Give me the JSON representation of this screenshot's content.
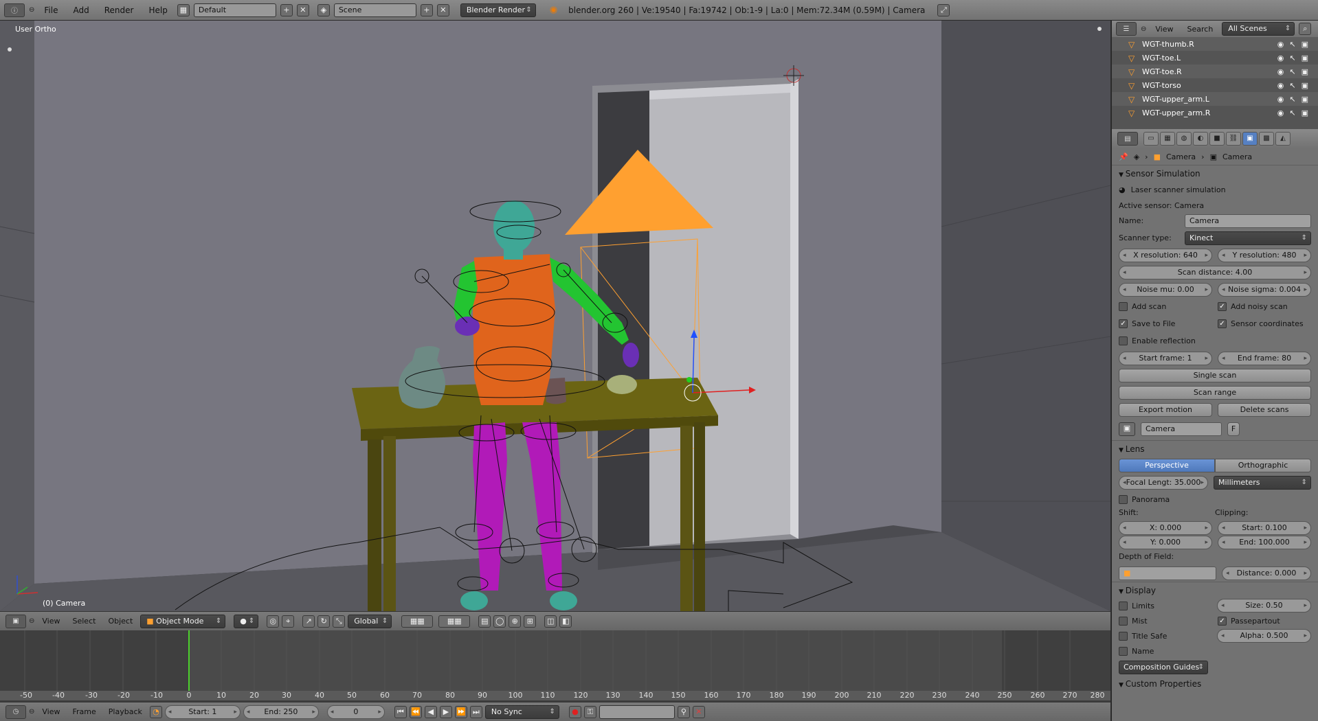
{
  "topbar": {
    "menus": [
      "File",
      "Add",
      "Render",
      "Help"
    ],
    "layout": "Default",
    "scene": "Scene",
    "engine": "Blender Render",
    "stats": "blender.org 260 | Ve:19540 | Fa:19742 | Ob:1-9 | La:0 | Mem:72.34M (0.59M) | Camera"
  },
  "viewport": {
    "view_label": "User Ortho",
    "object_label": "(0) Camera"
  },
  "viewport_header": {
    "menus": [
      "View",
      "Select",
      "Object"
    ],
    "mode": "Object Mode",
    "orientation": "Global"
  },
  "timeline": {
    "ruler": [
      "-50",
      "-40",
      "-30",
      "-20",
      "-10",
      "0",
      "10",
      "20",
      "30",
      "40",
      "50",
      "60",
      "70",
      "80",
      "90",
      "100",
      "110",
      "120",
      "130",
      "140",
      "150",
      "160",
      "170",
      "180",
      "190",
      "200",
      "210",
      "220",
      "230",
      "240",
      "250",
      "260",
      "270",
      "280"
    ],
    "menus": [
      "View",
      "Frame",
      "Playback"
    ],
    "start": "Start: 1",
    "end": "End: 250",
    "current": "0",
    "sync": "No Sync"
  },
  "outliner": {
    "header": {
      "view": "View",
      "search": "Search",
      "filter": "All Scenes"
    },
    "items": [
      "WGT-thumb.R",
      "WGT-toe.L",
      "WGT-toe.R",
      "WGT-torso",
      "WGT-upper_arm.L",
      "WGT-upper_arm.R"
    ]
  },
  "properties": {
    "breadcrumb": [
      "Camera",
      "Camera"
    ],
    "sensor": {
      "title": "Sensor Simulation",
      "laser": "Laser scanner simulation",
      "active": "Active sensor: Camera",
      "name_label": "Name:",
      "name_value": "Camera",
      "type_label": "Scanner type:",
      "type_value": "Kinect",
      "x_res": "X resolution: 640",
      "y_res": "Y resolution: 480",
      "scan_distance": "Scan distance: 4.00",
      "noise_mu": "Noise mu: 0.00",
      "noise_sigma": "Noise sigma: 0.004",
      "add_scan": "Add scan",
      "add_noisy": "Add noisy scan",
      "save_file": "Save to File",
      "sensor_coords": "Sensor coordinates",
      "reflection": "Enable reflection",
      "start_frame": "Start frame: 1",
      "end_frame": "End frame: 80",
      "single_scan": "Single scan",
      "scan_range": "Scan range",
      "export_motion": "Export motion",
      "delete_scans": "Delete scans"
    },
    "datablock": {
      "name": "Camera",
      "fake": "F"
    },
    "lens": {
      "title": "Lens",
      "perspective": "Perspective",
      "orthographic": "Orthographic",
      "focal": "Focal Lengt: 35.000",
      "units": "Millimeters",
      "panorama": "Panorama",
      "shift_label": "Shift:",
      "clipping_label": "Clipping:",
      "shift_x": "X: 0.000",
      "shift_y": "Y: 0.000",
      "clip_start": "Start: 0.100",
      "clip_end": "End: 100.000",
      "dof_label": "Depth of Field:",
      "distance": "Distance: 0.000"
    },
    "display": {
      "title": "Display",
      "limits": "Limits",
      "mist": "Mist",
      "title_safe": "Title Safe",
      "name": "Name",
      "size": "Size: 0.50",
      "passepartout": "Passepartout",
      "alpha": "Alpha: 0.500",
      "guides": "Composition Guides"
    },
    "custom": "Custom Properties"
  },
  "colors": {
    "selection_blue": "#5680c2",
    "camera_orange": "#ffa030",
    "torso_orange": "#e0641c",
    "arm_green": "#23c431",
    "leg_magenta": "#b11ab8",
    "skin_teal": "#3fa796",
    "table_olive": "#6b6413"
  }
}
